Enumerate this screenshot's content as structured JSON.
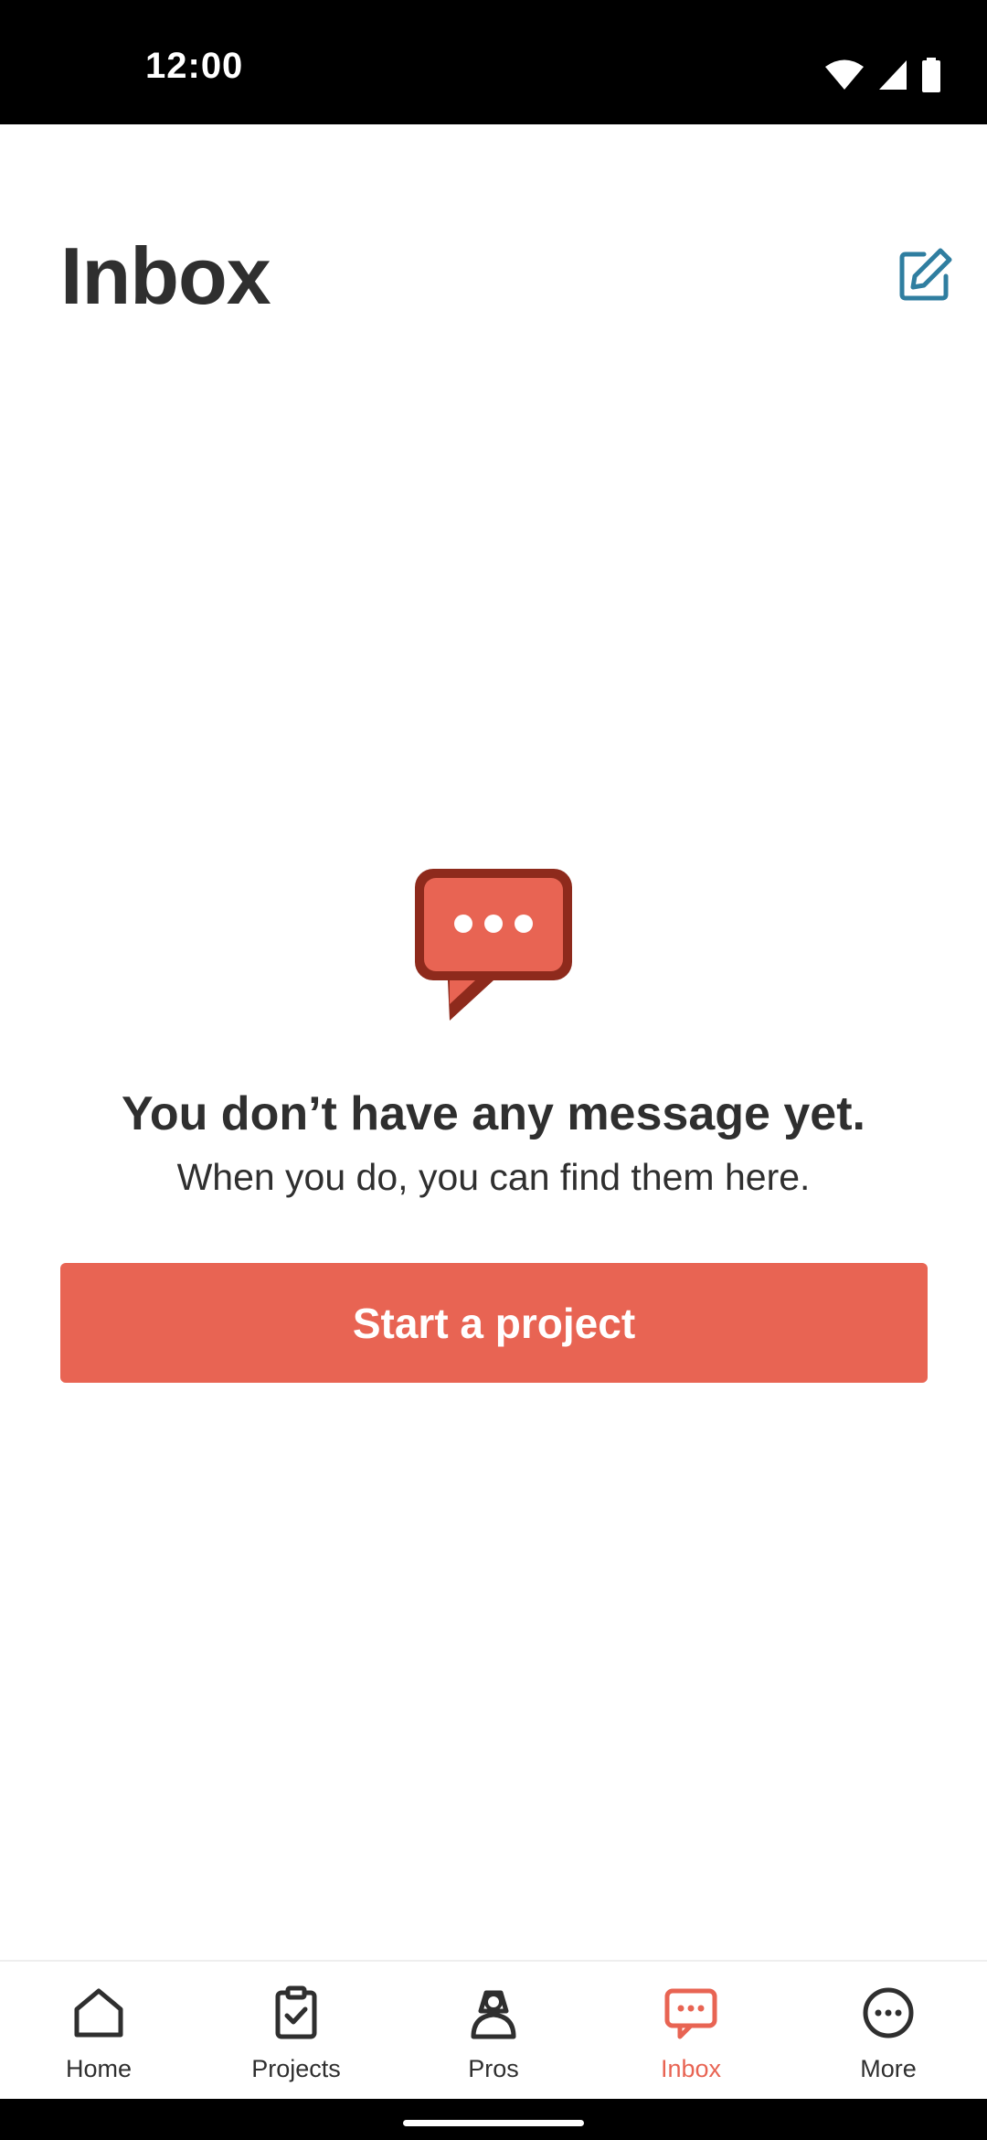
{
  "status_bar": {
    "time": "12:00",
    "icons": [
      "wifi-icon",
      "signal-icon",
      "battery-icon"
    ]
  },
  "header": {
    "title": "Inbox",
    "compose_icon": "compose-icon"
  },
  "empty_state": {
    "illustration_icon": "chat-bubble-icon",
    "heading": "You don’t have any message yet.",
    "subtext": "When you do, you can find them here.",
    "cta_label": "Start a project"
  },
  "bottom_nav": {
    "active": "Inbox",
    "items": [
      {
        "label": "Home",
        "icon": "home-icon"
      },
      {
        "label": "Projects",
        "icon": "clipboard-check-icon"
      },
      {
        "label": "Pros",
        "icon": "pro-person-icon"
      },
      {
        "label": "Inbox",
        "icon": "chat-icon"
      },
      {
        "label": "More",
        "icon": "more-icon"
      }
    ]
  },
  "colors": {
    "accent": "#e86453",
    "accent_dark": "#8e2a1c",
    "compose_icon": "#2f7ea0",
    "text": "#2f2f2f",
    "status_bar_bg": "#000000"
  }
}
